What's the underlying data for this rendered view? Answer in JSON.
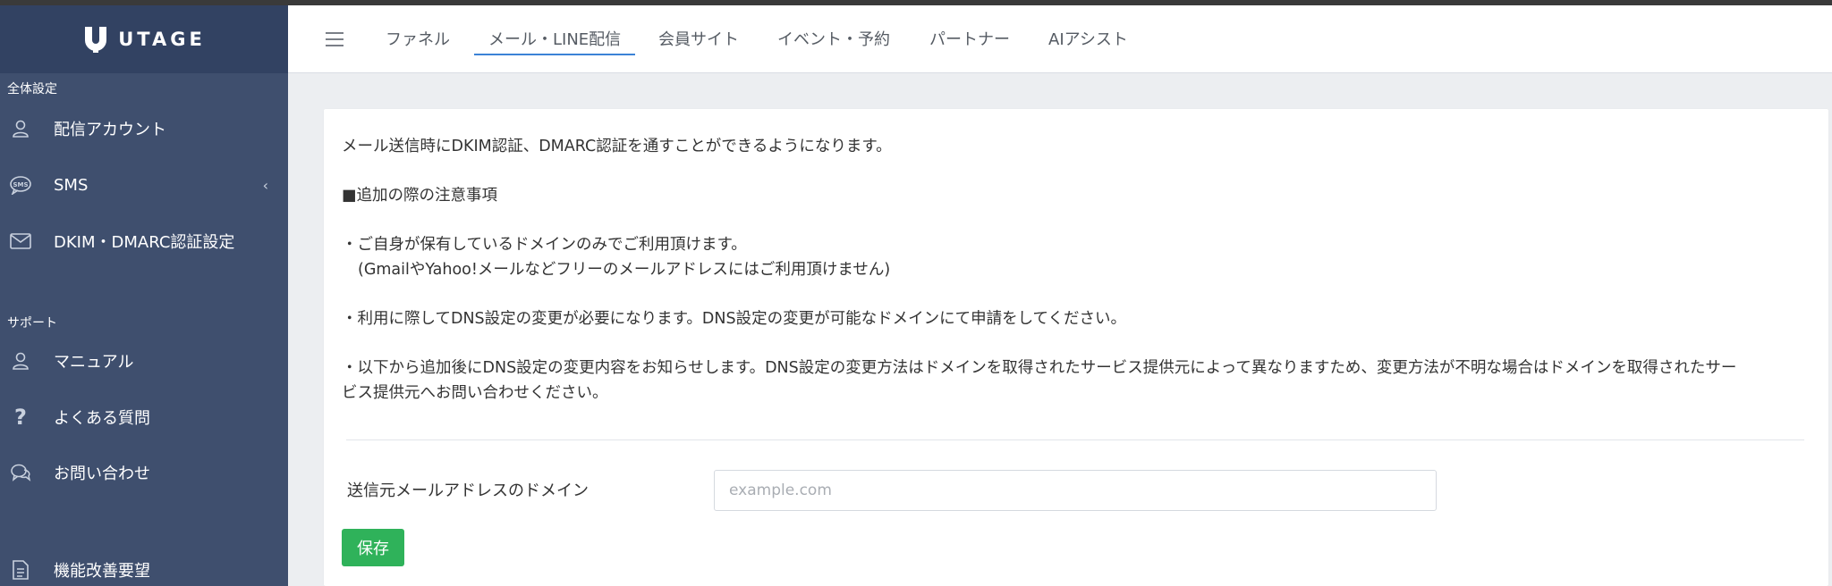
{
  "brand": {
    "name": "UTAGE"
  },
  "sidebar": {
    "sections": [
      {
        "label": "全体設定"
      },
      {
        "label": "サポート"
      }
    ],
    "items": [
      {
        "label": "配信アカウント",
        "icon": "user-icon"
      },
      {
        "label": "SMS",
        "icon": "sms-icon",
        "chevron": "‹"
      },
      {
        "label": "DKIM・DMARC認証設定",
        "icon": "mail-icon"
      },
      {
        "label": "マニュアル",
        "icon": "user-icon"
      },
      {
        "label": "よくある質問",
        "icon": "question-icon"
      },
      {
        "label": "お問い合わせ",
        "icon": "chat-icon"
      },
      {
        "label": "機能改善要望",
        "icon": "document-icon"
      }
    ]
  },
  "topnav": {
    "tabs": [
      {
        "label": "ファネル"
      },
      {
        "label": "メール・LINE配信",
        "active": true
      },
      {
        "label": "会員サイト"
      },
      {
        "label": "イベント・予約"
      },
      {
        "label": "パートナー"
      },
      {
        "label": "AIアシスト"
      }
    ]
  },
  "content": {
    "lines": [
      "メール送信時にDKIM認証、DMARC認証を通すことができるようになります。",
      "■追加の際の注意事項",
      "・ご自身が保有しているドメインのみでご利用頂けます。",
      "(GmailやYahoo!メールなどフリーのメールアドレスにはご利用頂けません)",
      "・利用に際してDNS設定の変更が必要になります。DNS設定の変更が可能なドメインにて申請をしてください。",
      "・以下から追加後にDNS設定の変更内容をお知らせします。DNS設定の変更方法はドメインを取得されたサービス提供元によって異なりますため、変更方法が不明な場合はドメインを取得されたサー",
      "ビス提供元へお問い合わせください。"
    ],
    "form": {
      "label": "送信元メールアドレスのドメイン",
      "value": "",
      "placeholder": "example.com",
      "save_label": "保存"
    }
  },
  "colors": {
    "sidebar_bg": "#3f4f6e",
    "logo_bar_bg": "#324262",
    "accent": "#3b82d6",
    "save_button": "#2fb25a"
  }
}
